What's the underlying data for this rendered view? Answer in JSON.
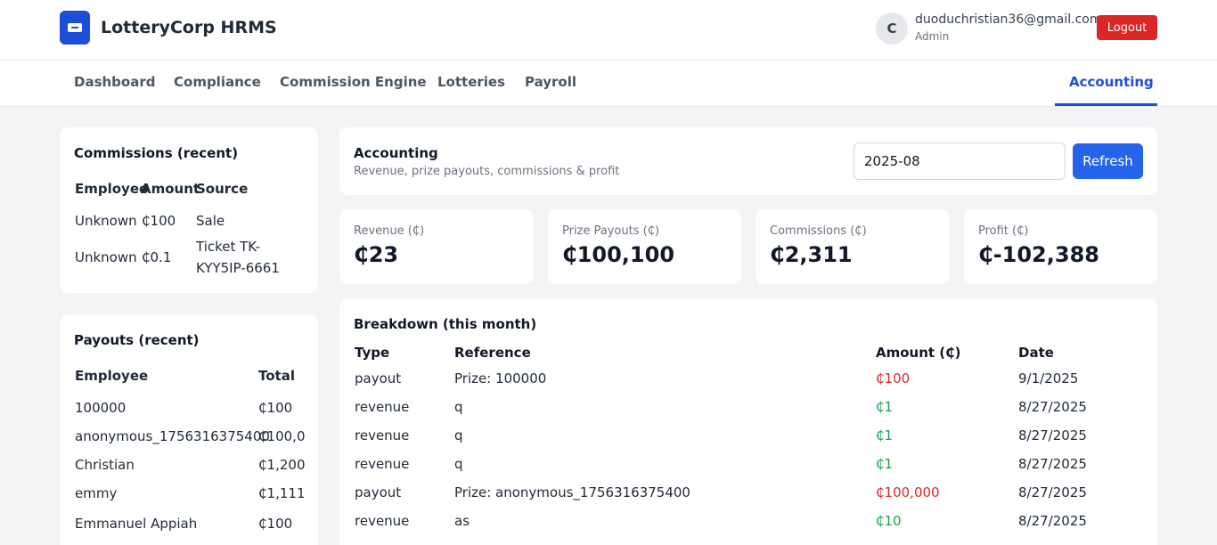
{
  "header": {
    "app_title": "LotteryCorp HRMS",
    "user": {
      "initial": "C",
      "email": "duoduchristian36@gmail.com",
      "role": "Admin"
    },
    "logout_label": "Logout",
    "brand_color": "#1d4ed8",
    "logout_color": "#dc2626"
  },
  "nav": {
    "items": [
      "Dashboard",
      "Compliance",
      "Commission Engine",
      "Lotteries",
      "Payroll",
      "Accounting"
    ],
    "active": "Accounting"
  },
  "commissions": {
    "title": "Commissions (recent)",
    "columns": [
      "Employee",
      "Amount",
      "Source"
    ],
    "rows": [
      {
        "employee": "Unknown",
        "amount": "₵100",
        "source": "Sale"
      },
      {
        "employee": "Unknown",
        "amount": "₵0.1",
        "source_line1": "Ticket TK-",
        "source_line2": "KYY5IP-6661"
      }
    ]
  },
  "payouts": {
    "title": "Payouts (recent)",
    "columns": [
      "Employee",
      "Total"
    ],
    "rows": [
      {
        "employee": "100000",
        "total": "₵100"
      },
      {
        "employee": "anonymous_1756316375400",
        "total": "₵100,0"
      },
      {
        "employee": "Christian",
        "total": "₵1,200"
      },
      {
        "employee": "emmy",
        "total": "₵1,111"
      },
      {
        "employee": "Emmanuel Appiah",
        "total": "₵100"
      }
    ]
  },
  "accounting": {
    "title": "Accounting",
    "subtitle": "Revenue, prize payouts, commissions & profit",
    "month_value": "2025-08",
    "refresh_label": "Refresh"
  },
  "stats": [
    {
      "label": "Revenue (₵)",
      "value": "₵23"
    },
    {
      "label": "Prize Payouts (₵)",
      "value": "₵100,100"
    },
    {
      "label": "Commissions (₵)",
      "value": "₵2,311"
    },
    {
      "label": "Profit (₵)",
      "value": "₵-102,388"
    }
  ],
  "breakdown": {
    "title": "Breakdown (this month)",
    "columns": [
      "Type",
      "Reference",
      "Amount (₵)",
      "Date"
    ],
    "rows": [
      {
        "type": "payout",
        "reference": "Prize: 100000",
        "amount": "₵100",
        "date": "9/1/2025"
      },
      {
        "type": "revenue",
        "reference": "q",
        "amount": "₵1",
        "date": "8/27/2025"
      },
      {
        "type": "revenue",
        "reference": "q",
        "amount": "₵1",
        "date": "8/27/2025"
      },
      {
        "type": "revenue",
        "reference": "q",
        "amount": "₵1",
        "date": "8/27/2025"
      },
      {
        "type": "payout",
        "reference": "Prize: anonymous_1756316375400",
        "amount": "₵100,000",
        "date": "8/27/2025"
      },
      {
        "type": "revenue",
        "reference": "as",
        "amount": "₵10",
        "date": "8/27/2025"
      }
    ],
    "payout_color": "#dc2626",
    "revenue_color": "#16a34a"
  }
}
